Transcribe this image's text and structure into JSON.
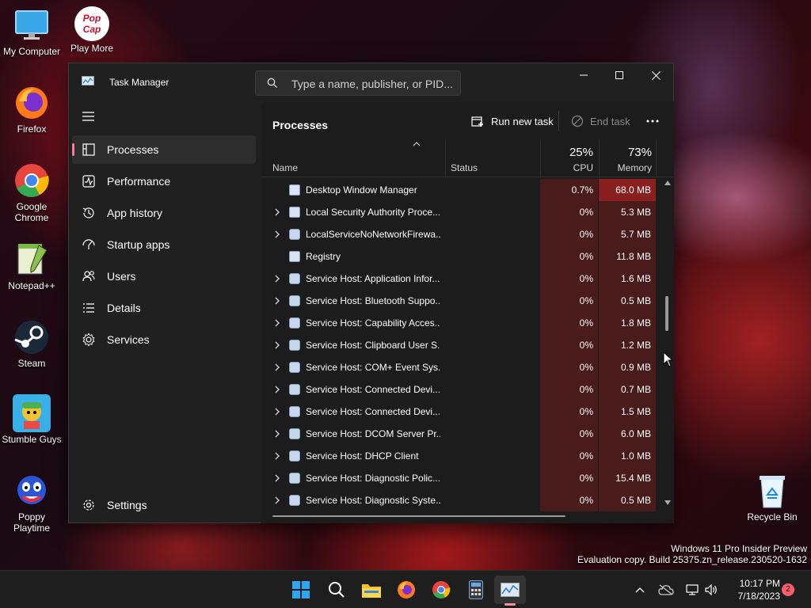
{
  "desktop": {
    "icons": [
      {
        "name": "desk-icon-my-computer",
        "label": "My Computer"
      },
      {
        "name": "desk-icon-play-more",
        "label": "Play More"
      },
      {
        "name": "desk-icon-firefox",
        "label": "Firefox"
      },
      {
        "name": "desk-icon-chrome",
        "label": "Google Chrome"
      },
      {
        "name": "desk-icon-notepad",
        "label": "Notepad++"
      },
      {
        "name": "desk-icon-steam",
        "label": "Steam"
      },
      {
        "name": "desk-icon-stumble",
        "label": "Stumble Guys"
      },
      {
        "name": "desk-icon-poppy",
        "label": "Poppy Playtime"
      },
      {
        "name": "desk-icon-recycle",
        "label": "Recycle Bin"
      }
    ],
    "popcap_text": "Pop Cap",
    "watermark_line1": "Windows 11 Pro Insider Preview",
    "watermark_line2": "Evaluation copy. Build 25375.zn_release.230520-1632"
  },
  "window": {
    "title": "Task Manager",
    "search_placeholder": "Type a name, publisher, or PID..."
  },
  "sidebar": {
    "items": [
      {
        "label": "Processes",
        "icon": "processes-icon",
        "active": true
      },
      {
        "label": "Performance",
        "icon": "performance-icon",
        "active": false
      },
      {
        "label": "App history",
        "icon": "app-history-icon",
        "active": false
      },
      {
        "label": "Startup apps",
        "icon": "startup-apps-icon",
        "active": false
      },
      {
        "label": "Users",
        "icon": "users-icon",
        "active": false
      },
      {
        "label": "Details",
        "icon": "details-icon",
        "active": false
      },
      {
        "label": "Services",
        "icon": "services-icon",
        "active": false
      }
    ],
    "settings_label": "Settings"
  },
  "main": {
    "page_title": "Processes",
    "run_new_task": "Run new task",
    "end_task": "End task",
    "columns": {
      "name": "Name",
      "status": "Status",
      "cpu_pct": "25%",
      "cpu": "CPU",
      "memory_pct": "73%",
      "memory": "Memory"
    },
    "rows": [
      {
        "name": "Desktop Window Manager",
        "expandable": false,
        "cpu": "0.7%",
        "memory": "68.0 MB",
        "hot": true,
        "icon": "window"
      },
      {
        "name": "Local Security Authority Proce...",
        "expandable": true,
        "cpu": "0%",
        "memory": "5.3 MB",
        "hot": false,
        "icon": "window"
      },
      {
        "name": "LocalServiceNoNetworkFirewa...",
        "expandable": true,
        "cpu": "0%",
        "memory": "5.7 MB",
        "hot": false,
        "icon": "gear"
      },
      {
        "name": "Registry",
        "expandable": false,
        "cpu": "0%",
        "memory": "11.8 MB",
        "hot": false,
        "icon": "window"
      },
      {
        "name": "Service Host: Application Infor...",
        "expandable": true,
        "cpu": "0%",
        "memory": "1.6 MB",
        "hot": false,
        "icon": "gear"
      },
      {
        "name": "Service Host: Bluetooth Suppo...",
        "expandable": true,
        "cpu": "0%",
        "memory": "0.5 MB",
        "hot": false,
        "icon": "gear"
      },
      {
        "name": "Service Host: Capability Acces...",
        "expandable": true,
        "cpu": "0%",
        "memory": "1.8 MB",
        "hot": false,
        "icon": "gear"
      },
      {
        "name": "Service Host: Clipboard User S...",
        "expandable": true,
        "cpu": "0%",
        "memory": "1.2 MB",
        "hot": false,
        "icon": "gear"
      },
      {
        "name": "Service Host: COM+ Event Sys...",
        "expandable": true,
        "cpu": "0%",
        "memory": "0.9 MB",
        "hot": false,
        "icon": "gear"
      },
      {
        "name": "Service Host: Connected Devi...",
        "expandable": true,
        "cpu": "0%",
        "memory": "0.7 MB",
        "hot": false,
        "icon": "gear"
      },
      {
        "name": "Service Host: Connected Devi...",
        "expandable": true,
        "cpu": "0%",
        "memory": "1.5 MB",
        "hot": false,
        "icon": "gear"
      },
      {
        "name": "Service Host: DCOM Server Pr...",
        "expandable": true,
        "cpu": "0%",
        "memory": "6.0 MB",
        "hot": false,
        "icon": "gear"
      },
      {
        "name": "Service Host: DHCP Client",
        "expandable": true,
        "cpu": "0%",
        "memory": "1.0 MB",
        "hot": false,
        "icon": "gear"
      },
      {
        "name": "Service Host: Diagnostic Polic...",
        "expandable": true,
        "cpu": "0%",
        "memory": "15.4 MB",
        "hot": false,
        "icon": "gear"
      },
      {
        "name": "Service Host: Diagnostic Syste...",
        "expandable": true,
        "cpu": "0%",
        "memory": "0.5 MB",
        "hot": false,
        "icon": "gear"
      }
    ]
  },
  "taskbar": {
    "time": "10:17 PM",
    "date": "7/18/2023",
    "notification_count": "2"
  },
  "colors": {
    "accent": "#ff7a9a",
    "heat_low": "#4a1b1b",
    "heat_high": "#8a1f1f"
  }
}
